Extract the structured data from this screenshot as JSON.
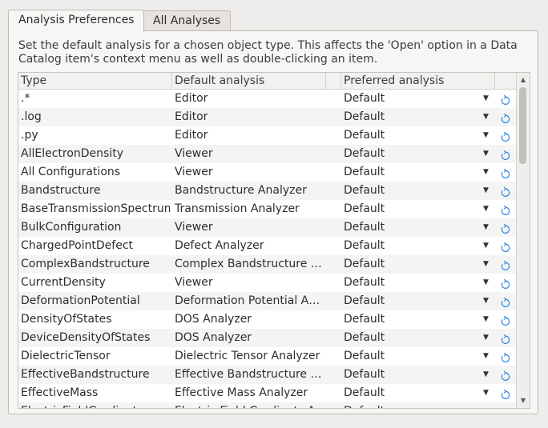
{
  "tabs": [
    {
      "label": "Analysis Preferences",
      "active": true
    },
    {
      "label": "All Analyses",
      "active": false
    }
  ],
  "description": "Set the default analysis for a chosen object type. This affects the 'Open' option in a Data Catalog item's context menu as well as double-clicking an item.",
  "table": {
    "columns": [
      "Type",
      "Default analysis",
      "Preferred analysis"
    ],
    "rows": [
      {
        "type": ".*",
        "default": "Editor",
        "preferred": "Default"
      },
      {
        "type": ".log",
        "default": "Editor",
        "preferred": "Default"
      },
      {
        "type": ".py",
        "default": "Editor",
        "preferred": "Default"
      },
      {
        "type": "AllElectronDensity",
        "default": "Viewer",
        "preferred": "Default"
      },
      {
        "type": "All Configurations",
        "default": "Viewer",
        "preferred": "Default"
      },
      {
        "type": "Bandstructure",
        "default": "Bandstructure Analyzer",
        "preferred": "Default"
      },
      {
        "type": "BaseTransmissionSpectrum",
        "default": "Transmission Analyzer",
        "preferred": "Default"
      },
      {
        "type": "BulkConfiguration",
        "default": "Viewer",
        "preferred": "Default"
      },
      {
        "type": "ChargedPointDefect",
        "default": "Defect Analyzer",
        "preferred": "Default"
      },
      {
        "type": "ComplexBandstructure",
        "default": "Complex Bandstructure …",
        "preferred": "Default"
      },
      {
        "type": "CurrentDensity",
        "default": "Viewer",
        "preferred": "Default"
      },
      {
        "type": "DeformationPotential",
        "default": "Deformation Potential A…",
        "preferred": "Default"
      },
      {
        "type": "DensityOfStates",
        "default": "DOS Analyzer",
        "preferred": "Default"
      },
      {
        "type": "DeviceDensityOfStates",
        "default": "DOS Analyzer",
        "preferred": "Default"
      },
      {
        "type": "DielectricTensor",
        "default": "Dielectric Tensor Analyzer",
        "preferred": "Default"
      },
      {
        "type": "EffectiveBandstructure",
        "default": "Effective Bandstructure …",
        "preferred": "Default"
      },
      {
        "type": "EffectiveMass",
        "default": "Effective Mass Analyzer",
        "preferred": "Default"
      },
      {
        "type": "ElectricFieldGradients",
        "default": "Electric Field Gradients A…",
        "preferred": "Default"
      }
    ]
  },
  "icons": {
    "dropdown": "chevron-down-icon",
    "reset": "reset-icon",
    "scroll_up": "arrow-up-icon",
    "scroll_down": "arrow-down-icon"
  },
  "colors": {
    "reset_icon": "#3d8ee0"
  }
}
